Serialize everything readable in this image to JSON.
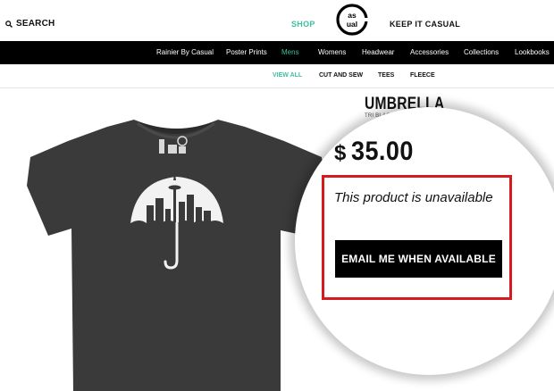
{
  "header": {
    "search_label": "SEARCH",
    "shop_label": "SHOP",
    "keep_label": "KEEP IT CASUAL",
    "logo_text": "casual",
    "accent_color": "#3cc0a0"
  },
  "nav": {
    "items": [
      {
        "label": "Rainier By Casual"
      },
      {
        "label": "Poster Prints"
      },
      {
        "label": "Mens"
      },
      {
        "label": "Womens"
      },
      {
        "label": "Headwear"
      },
      {
        "label": "Accessories"
      },
      {
        "label": "Collections"
      },
      {
        "label": "Lookbooks"
      }
    ],
    "active": "Mens"
  },
  "subnav": {
    "items": [
      {
        "label": "VIEW ALL"
      },
      {
        "label": "CUT AND SEW"
      },
      {
        "label": "TEES"
      },
      {
        "label": "FLEECE"
      }
    ],
    "active": "VIEW ALL"
  },
  "product": {
    "title": "UMBRELLA",
    "subtitle": "TRI BLACK",
    "currency": "$",
    "price": "35.00",
    "availability": "This product is unavailable",
    "email_button": "EMAIL ME WHEN AVAILABLE",
    "highlight_color": "#d71920"
  }
}
